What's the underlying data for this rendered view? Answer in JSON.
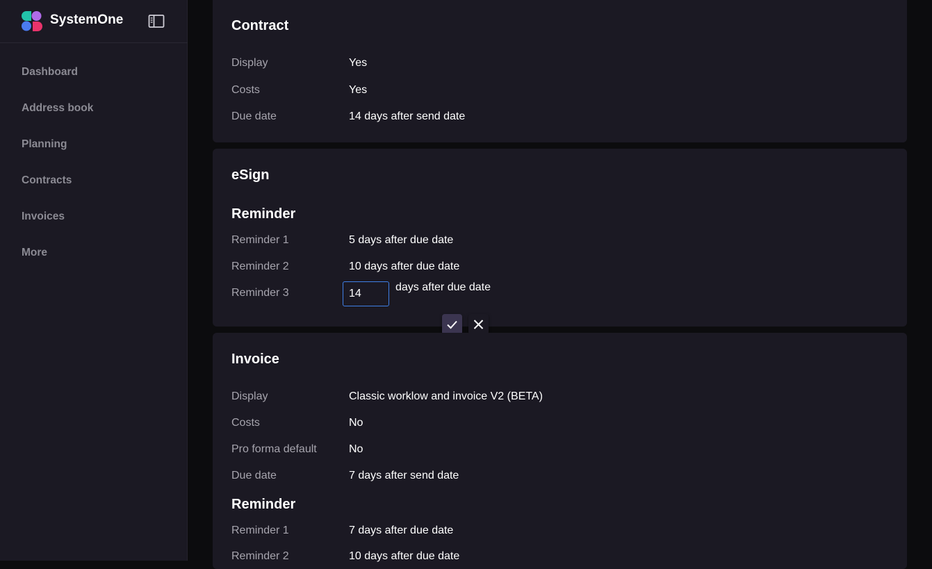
{
  "app": {
    "name": "SystemOne"
  },
  "sidebar": {
    "items": [
      {
        "label": "Dashboard"
      },
      {
        "label": "Address book"
      },
      {
        "label": "Planning"
      },
      {
        "label": "Contracts"
      },
      {
        "label": "Invoices"
      },
      {
        "label": "More"
      }
    ]
  },
  "contract": {
    "title": "Contract",
    "rows": [
      {
        "label": "Display",
        "value": "Yes"
      },
      {
        "label": "Costs",
        "value": "Yes"
      },
      {
        "label": "Due date",
        "value": "14 days after send date"
      }
    ]
  },
  "esign": {
    "title": "eSign",
    "reminder_heading": "Reminder",
    "rows": [
      {
        "label": "Reminder 1",
        "value": "5 days after due date"
      },
      {
        "label": "Reminder 2",
        "value": "10 days after due date"
      },
      {
        "label": "Reminder 3"
      }
    ],
    "edit": {
      "input_value": "14",
      "suffix": "days after due date"
    }
  },
  "invoice": {
    "title": "Invoice",
    "rows": [
      {
        "label": "Display",
        "value": "Classic worklow and invoice V2 (BETA)"
      },
      {
        "label": "Costs",
        "value": "No"
      },
      {
        "label": "Pro forma default",
        "value": "No"
      },
      {
        "label": "Due date",
        "value": "7 days after send date"
      }
    ],
    "reminder_heading": "Reminder",
    "reminders": [
      {
        "label": "Reminder 1",
        "value": "7 days after due date"
      },
      {
        "label": "Reminder 2",
        "value": "10 days after due date"
      }
    ]
  },
  "colors": {
    "background": "#0c0c0e",
    "panel": "#1b1923",
    "muted_text": "#a6a4ad",
    "focus_border": "#3f7fe6",
    "confirm_button": "#3b3550"
  },
  "icons": {
    "logo": "systemone-logo",
    "collapse": "sidebar-toggle-icon",
    "confirm": "check-icon",
    "cancel": "close-icon"
  }
}
